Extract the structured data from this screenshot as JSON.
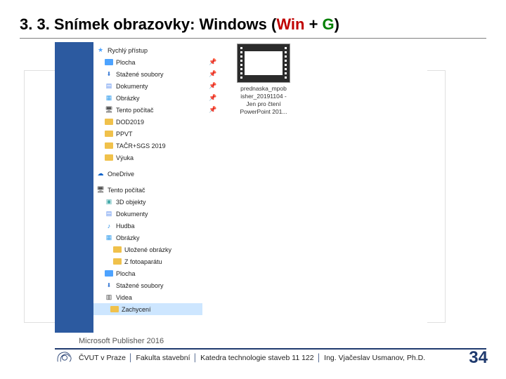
{
  "title": {
    "pre": "3. 3. Snímek obrazovky: Windows (",
    "win": "Win",
    "mid": " + ",
    "g": "G",
    "post": ")"
  },
  "glyph": {
    "pin": "📌",
    "star": "★",
    "cloud": "☁",
    "pc": "🖥",
    "cube": "▣",
    "doc": "▤",
    "note": "♪",
    "pic": "▦",
    "vid": "▥",
    "down": "⬇"
  },
  "nav": {
    "quick": "Rychlý přístup",
    "desktop": "Plocha",
    "downloads": "Stažené soubory",
    "documents": "Dokumenty",
    "pictures": "Obrázky",
    "thispc1": "Tento počítač",
    "f1": "DOD2019",
    "f2": "PPVT",
    "f3": "TAČR+SGS 2019",
    "f4": "Výuka",
    "onedrive": "OneDrive",
    "thispc2": "Tento počítač",
    "obj3d": "3D objekty",
    "documents2": "Dokumenty",
    "music": "Hudba",
    "pictures2": "Obrázky",
    "saved": "Uložené obrázky",
    "camera": "Z fotoaparátu",
    "desktop2": "Plocha",
    "downloads2": "Stažené soubory",
    "videos": "Videa",
    "captures": "Zachycení"
  },
  "file": {
    "l1": "prednaska_mpob",
    "l2": "isher_20191104 -",
    "l3": "Jen pro čtení",
    "l4": "PowerPoint 201..."
  },
  "software": "Microsoft Publisher  2016",
  "footer": {
    "a": "ČVUT v Praze",
    "b": "Fakulta stavební",
    "c": "Katedra technologie staveb 11 122",
    "d": "Ing. Vjačeslav Usmanov, Ph.D."
  },
  "page": "34"
}
